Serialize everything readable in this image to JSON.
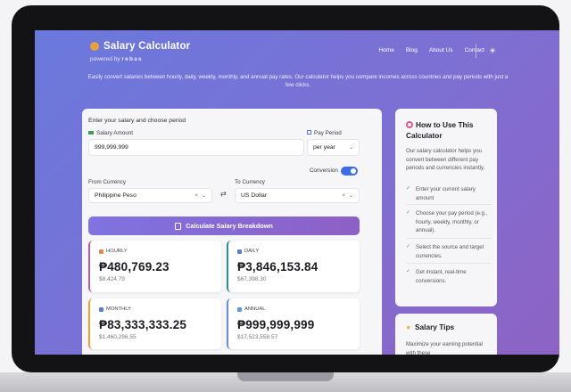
{
  "header": {
    "title": "Salary Calculator",
    "powered_by": "powered by",
    "brand": "rebas",
    "nav": [
      "Home",
      "Blog",
      "About Us",
      "Contact"
    ],
    "description": "Easily convert salaries between hourly, daily, weekly, monthly, and annual pay rates. Our calculator helps you compare incomes across countries and pay periods with just a few clicks."
  },
  "form": {
    "heading": "Enter your salary and choose period",
    "salary_label": "Salary Amount",
    "salary_value": "999,999,999",
    "period_label": "Pay Period",
    "period_value": "per year",
    "conversion_label": "Conversion",
    "conversion_on": true,
    "from_label": "From Currency",
    "from_value": "Philippine Peso",
    "to_label": "To Currency",
    "to_value": "US Dollar",
    "calculate_label": "Calculate Salary Breakdown"
  },
  "results": [
    {
      "label": "HOURLY",
      "value": "₱480,769.23",
      "converted": "$8,424.79",
      "color": "#b15ea7"
    },
    {
      "label": "DAILY",
      "value": "₱3,846,153.84",
      "converted": "$67,398.30",
      "color": "#2e8f86"
    },
    {
      "label": "MONTHLY",
      "value": "₱83,333,333.25",
      "converted": "$1,460,296.55",
      "color": "#e3a23a"
    },
    {
      "label": "ANNUAL",
      "value": "₱999,999,999",
      "converted": "$17,523,558.57",
      "color": "#6a8bd6"
    }
  ],
  "sidebar": {
    "how_title": "How to Use This Calculator",
    "intro": "Our salary calculator helps you convert between different pay periods and currencies instantly.",
    "steps": [
      "Enter your current salary amount",
      "Choose your pay period (e.g., hourly, weekly, monthly, or annual).",
      "Select the source and target currencies.",
      "Get instant, real-time conversions."
    ],
    "tips_title": "Salary Tips",
    "tips_text": "Maximize your earning potential with these"
  }
}
